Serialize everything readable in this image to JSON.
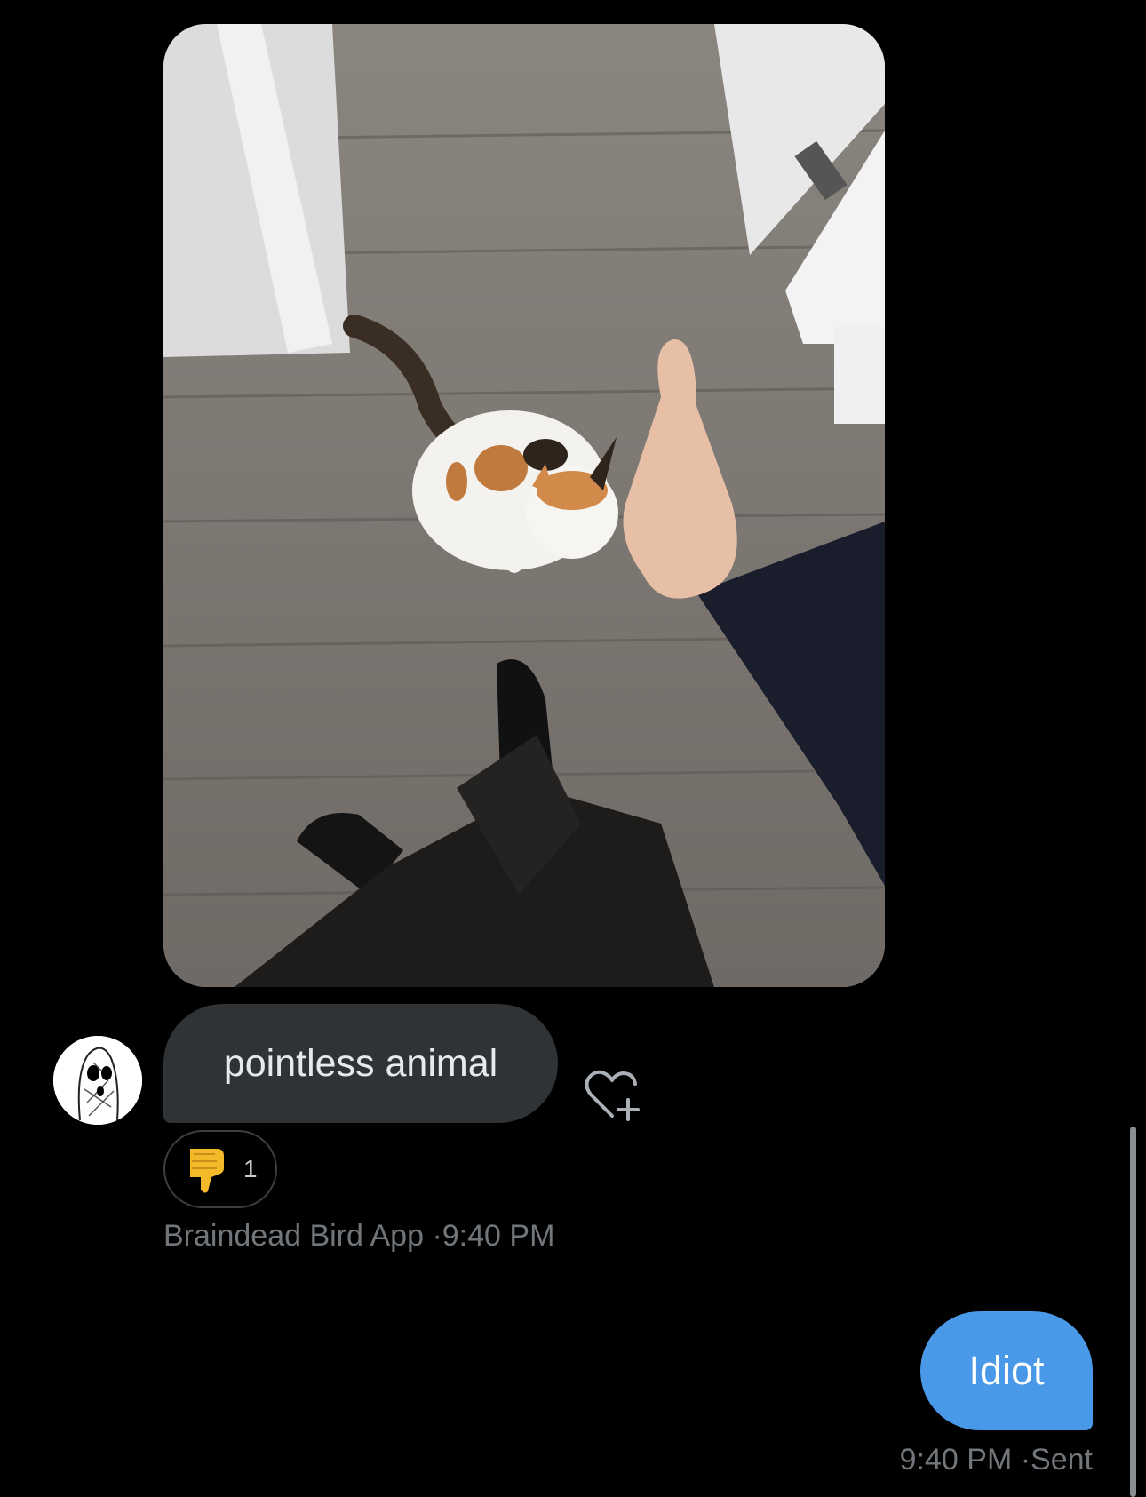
{
  "thread": {
    "photo": {
      "description_icon": "photo-attachment"
    },
    "incoming": {
      "text": "pointless animal",
      "reaction": {
        "emoji": "thumbs-down",
        "count": "1"
      },
      "sender": "Braindead Bird App",
      "separator": "·",
      "time": "9:40 PM"
    },
    "outgoing": {
      "text": "Idiot",
      "time": "9:40 PM",
      "separator": "·",
      "status": "Sent"
    }
  },
  "colors": {
    "background": "#000000",
    "incoming_bubble": "#2f3336",
    "outgoing_bubble": "#4a99e9",
    "meta_text": "#71767b"
  }
}
